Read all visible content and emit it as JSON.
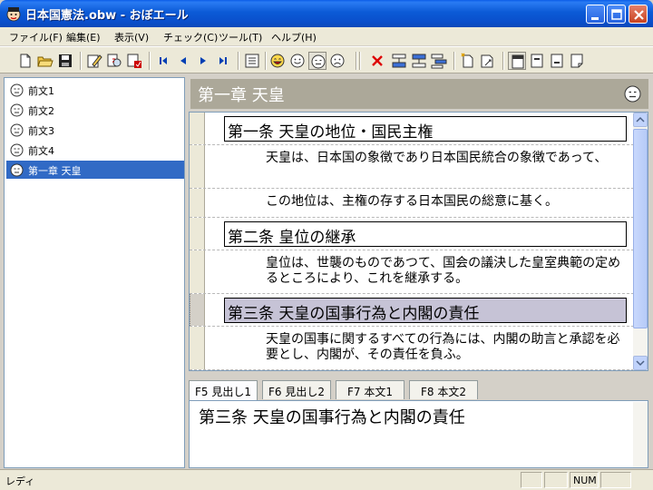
{
  "window": {
    "title": "日本国憲法.obw - おぼエール"
  },
  "menu": [
    {
      "label": "ファイル(F)"
    },
    {
      "label": "編集(E)"
    },
    {
      "label": "表示(V)"
    },
    {
      "label": "チェック(C)"
    },
    {
      "label": "ツール(T)"
    },
    {
      "label": "ヘルプ(H)"
    }
  ],
  "toolbar": {
    "icons": [
      "new-file-icon",
      "open-folder-icon",
      "save-icon",
      "edit-icon",
      "edit-find-icon",
      "check-icon",
      "first-icon",
      "prev-icon",
      "next-icon",
      "last-icon",
      "list-icon",
      "face-happy-icon",
      "face-smile-icon",
      "face-neutral-icon",
      "face-sad-icon",
      "delete-icon",
      "insert-before-icon",
      "insert-after-icon",
      "insert-child-icon",
      "new-note-icon",
      "open-note-icon",
      "view-mode-1-icon",
      "view-mode-2-icon",
      "view-mode-3-icon",
      "view-mode-4-icon"
    ]
  },
  "tree": {
    "items": [
      {
        "label": "前文1",
        "face": "face-neutral-icon"
      },
      {
        "label": "前文2",
        "face": "face-neutral-icon"
      },
      {
        "label": "前文3",
        "face": "face-neutral-icon"
      },
      {
        "label": "前文4",
        "face": "face-neutral-icon"
      },
      {
        "label": "第一章  天皇",
        "face": "face-neutral-icon",
        "selected": true
      }
    ]
  },
  "chapter": {
    "title": "第一章  天皇"
  },
  "rows": [
    {
      "type": "heading",
      "text": "第一条  天皇の地位・国民主権"
    },
    {
      "type": "body",
      "text": "天皇は、日本国の象徴であり日本国民統合の象徴であって、"
    },
    {
      "type": "body",
      "text": "この地位は、主権の存する日本国民の総意に基く。"
    },
    {
      "type": "heading",
      "text": "第二条  皇位の継承"
    },
    {
      "type": "body",
      "text": "皇位は、世襲のものであつて、国会の議決した皇室典範の定めるところにより、これを継承する。"
    },
    {
      "type": "heading",
      "text": "第三条  天皇の国事行為と内閣の責任",
      "selected": true
    },
    {
      "type": "body",
      "text": "天皇の国事に関するすべての行為には、内閣の助言と承認を必要とし、内閣が、その責任を負ふ。"
    }
  ],
  "tabs": [
    {
      "label": "F5 見出し1",
      "active": true
    },
    {
      "label": "F6 見出し2"
    },
    {
      "label": "F7 本文1"
    },
    {
      "label": "F8 本文2"
    }
  ],
  "editor": {
    "text": "第三条  天皇の国事行為と内閣の責任"
  },
  "status": {
    "text": "レディ",
    "num": "NUM"
  }
}
